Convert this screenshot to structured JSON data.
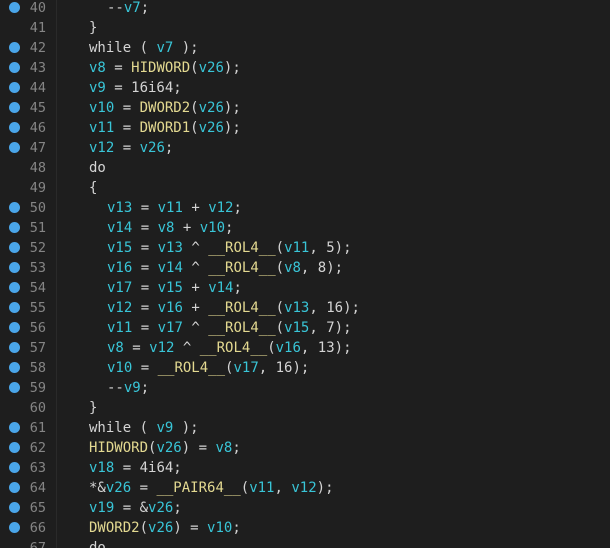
{
  "editor": {
    "colors": {
      "background": "#1e1e1e",
      "breakpoint": "#4aa5e8",
      "line_number": "#858585",
      "identifier": "#39c5d7",
      "function": "#e3d991",
      "text": "#d4d4d4"
    },
    "lines": [
      {
        "num": "40",
        "bp": true,
        "indent": 2,
        "tokens": [
          {
            "t": "--",
            "k": "op"
          },
          {
            "t": "v7",
            "k": "id"
          },
          {
            "t": ";",
            "k": "op"
          }
        ]
      },
      {
        "num": "41",
        "bp": false,
        "indent": 1,
        "tokens": [
          {
            "t": "}",
            "k": "op"
          }
        ]
      },
      {
        "num": "42",
        "bp": true,
        "indent": 1,
        "tokens": [
          {
            "t": "while ( ",
            "k": "kw"
          },
          {
            "t": "v7",
            "k": "id"
          },
          {
            "t": " );",
            "k": "op"
          }
        ]
      },
      {
        "num": "43",
        "bp": true,
        "indent": 1,
        "tokens": [
          {
            "t": "v8",
            "k": "id"
          },
          {
            "t": " = ",
            "k": "op"
          },
          {
            "t": "HIDWORD",
            "k": "fn"
          },
          {
            "t": "(",
            "k": "op"
          },
          {
            "t": "v26",
            "k": "id"
          },
          {
            "t": ");",
            "k": "op"
          }
        ]
      },
      {
        "num": "44",
        "bp": true,
        "indent": 1,
        "tokens": [
          {
            "t": "v9",
            "k": "id"
          },
          {
            "t": " = 16i64;",
            "k": "op"
          }
        ]
      },
      {
        "num": "45",
        "bp": true,
        "indent": 1,
        "tokens": [
          {
            "t": "v10",
            "k": "id"
          },
          {
            "t": " = ",
            "k": "op"
          },
          {
            "t": "DWORD2",
            "k": "fn"
          },
          {
            "t": "(",
            "k": "op"
          },
          {
            "t": "v26",
            "k": "id"
          },
          {
            "t": ");",
            "k": "op"
          }
        ]
      },
      {
        "num": "46",
        "bp": true,
        "indent": 1,
        "tokens": [
          {
            "t": "v11",
            "k": "id"
          },
          {
            "t": " = ",
            "k": "op"
          },
          {
            "t": "DWORD1",
            "k": "fn"
          },
          {
            "t": "(",
            "k": "op"
          },
          {
            "t": "v26",
            "k": "id"
          },
          {
            "t": ");",
            "k": "op"
          }
        ]
      },
      {
        "num": "47",
        "bp": true,
        "indent": 1,
        "tokens": [
          {
            "t": "v12",
            "k": "id"
          },
          {
            "t": " = ",
            "k": "op"
          },
          {
            "t": "v26",
            "k": "id"
          },
          {
            "t": ";",
            "k": "op"
          }
        ]
      },
      {
        "num": "48",
        "bp": false,
        "indent": 1,
        "tokens": [
          {
            "t": "do",
            "k": "kw"
          }
        ]
      },
      {
        "num": "49",
        "bp": false,
        "indent": 1,
        "tokens": [
          {
            "t": "{",
            "k": "op"
          }
        ]
      },
      {
        "num": "50",
        "bp": true,
        "indent": 2,
        "tokens": [
          {
            "t": "v13",
            "k": "id"
          },
          {
            "t": " = ",
            "k": "op"
          },
          {
            "t": "v11",
            "k": "id"
          },
          {
            "t": " + ",
            "k": "op"
          },
          {
            "t": "v12",
            "k": "id"
          },
          {
            "t": ";",
            "k": "op"
          }
        ]
      },
      {
        "num": "51",
        "bp": true,
        "indent": 2,
        "tokens": [
          {
            "t": "v14",
            "k": "id"
          },
          {
            "t": " = ",
            "k": "op"
          },
          {
            "t": "v8",
            "k": "id"
          },
          {
            "t": " + ",
            "k": "op"
          },
          {
            "t": "v10",
            "k": "id"
          },
          {
            "t": ";",
            "k": "op"
          }
        ]
      },
      {
        "num": "52",
        "bp": true,
        "indent": 2,
        "tokens": [
          {
            "t": "v15",
            "k": "id"
          },
          {
            "t": " = ",
            "k": "op"
          },
          {
            "t": "v13",
            "k": "id"
          },
          {
            "t": " ^ ",
            "k": "op"
          },
          {
            "t": "__ROL4__",
            "k": "fn"
          },
          {
            "t": "(",
            "k": "op"
          },
          {
            "t": "v11",
            "k": "id"
          },
          {
            "t": ", 5);",
            "k": "op"
          }
        ]
      },
      {
        "num": "53",
        "bp": true,
        "indent": 2,
        "tokens": [
          {
            "t": "v16",
            "k": "id"
          },
          {
            "t": " = ",
            "k": "op"
          },
          {
            "t": "v14",
            "k": "id"
          },
          {
            "t": " ^ ",
            "k": "op"
          },
          {
            "t": "__ROL4__",
            "k": "fn"
          },
          {
            "t": "(",
            "k": "op"
          },
          {
            "t": "v8",
            "k": "id"
          },
          {
            "t": ", 8);",
            "k": "op"
          }
        ]
      },
      {
        "num": "54",
        "bp": true,
        "indent": 2,
        "tokens": [
          {
            "t": "v17",
            "k": "id"
          },
          {
            "t": " = ",
            "k": "op"
          },
          {
            "t": "v15",
            "k": "id"
          },
          {
            "t": " + ",
            "k": "op"
          },
          {
            "t": "v14",
            "k": "id"
          },
          {
            "t": ";",
            "k": "op"
          }
        ]
      },
      {
        "num": "55",
        "bp": true,
        "indent": 2,
        "tokens": [
          {
            "t": "v12",
            "k": "id"
          },
          {
            "t": " = ",
            "k": "op"
          },
          {
            "t": "v16",
            "k": "id"
          },
          {
            "t": " + ",
            "k": "op"
          },
          {
            "t": "__ROL4__",
            "k": "fn"
          },
          {
            "t": "(",
            "k": "op"
          },
          {
            "t": "v13",
            "k": "id"
          },
          {
            "t": ", 16);",
            "k": "op"
          }
        ]
      },
      {
        "num": "56",
        "bp": true,
        "indent": 2,
        "tokens": [
          {
            "t": "v11",
            "k": "id"
          },
          {
            "t": " = ",
            "k": "op"
          },
          {
            "t": "v17",
            "k": "id"
          },
          {
            "t": " ^ ",
            "k": "op"
          },
          {
            "t": "__ROL4__",
            "k": "fn"
          },
          {
            "t": "(",
            "k": "op"
          },
          {
            "t": "v15",
            "k": "id"
          },
          {
            "t": ", 7);",
            "k": "op"
          }
        ]
      },
      {
        "num": "57",
        "bp": true,
        "indent": 2,
        "tokens": [
          {
            "t": "v8",
            "k": "id"
          },
          {
            "t": " = ",
            "k": "op"
          },
          {
            "t": "v12",
            "k": "id"
          },
          {
            "t": " ^ ",
            "k": "op"
          },
          {
            "t": "__ROL4__",
            "k": "fn"
          },
          {
            "t": "(",
            "k": "op"
          },
          {
            "t": "v16",
            "k": "id"
          },
          {
            "t": ", 13);",
            "k": "op"
          }
        ]
      },
      {
        "num": "58",
        "bp": true,
        "indent": 2,
        "tokens": [
          {
            "t": "v10",
            "k": "id"
          },
          {
            "t": " = ",
            "k": "op"
          },
          {
            "t": "__ROL4__",
            "k": "fn"
          },
          {
            "t": "(",
            "k": "op"
          },
          {
            "t": "v17",
            "k": "id"
          },
          {
            "t": ", 16);",
            "k": "op"
          }
        ]
      },
      {
        "num": "59",
        "bp": true,
        "indent": 2,
        "tokens": [
          {
            "t": "--",
            "k": "op"
          },
          {
            "t": "v9",
            "k": "id"
          },
          {
            "t": ";",
            "k": "op"
          }
        ]
      },
      {
        "num": "60",
        "bp": false,
        "indent": 1,
        "tokens": [
          {
            "t": "}",
            "k": "op"
          }
        ]
      },
      {
        "num": "61",
        "bp": true,
        "indent": 1,
        "tokens": [
          {
            "t": "while ( ",
            "k": "kw"
          },
          {
            "t": "v9",
            "k": "id"
          },
          {
            "t": " );",
            "k": "op"
          }
        ]
      },
      {
        "num": "62",
        "bp": true,
        "indent": 1,
        "tokens": [
          {
            "t": "HIDWORD",
            "k": "fn"
          },
          {
            "t": "(",
            "k": "op"
          },
          {
            "t": "v26",
            "k": "id"
          },
          {
            "t": ") = ",
            "k": "op"
          },
          {
            "t": "v8",
            "k": "id"
          },
          {
            "t": ";",
            "k": "op"
          }
        ]
      },
      {
        "num": "63",
        "bp": true,
        "indent": 1,
        "tokens": [
          {
            "t": "v18",
            "k": "id"
          },
          {
            "t": " = 4i64;",
            "k": "op"
          }
        ]
      },
      {
        "num": "64",
        "bp": true,
        "indent": 1,
        "tokens": [
          {
            "t": "*&",
            "k": "op"
          },
          {
            "t": "v26",
            "k": "id"
          },
          {
            "t": " = ",
            "k": "op"
          },
          {
            "t": "__PAIR64__",
            "k": "fn"
          },
          {
            "t": "(",
            "k": "op"
          },
          {
            "t": "v11",
            "k": "id"
          },
          {
            "t": ", ",
            "k": "op"
          },
          {
            "t": "v12",
            "k": "id"
          },
          {
            "t": ");",
            "k": "op"
          }
        ]
      },
      {
        "num": "65",
        "bp": true,
        "indent": 1,
        "tokens": [
          {
            "t": "v19",
            "k": "id"
          },
          {
            "t": " = &",
            "k": "op"
          },
          {
            "t": "v26",
            "k": "id"
          },
          {
            "t": ";",
            "k": "op"
          }
        ]
      },
      {
        "num": "66",
        "bp": true,
        "indent": 1,
        "tokens": [
          {
            "t": "DWORD2",
            "k": "fn"
          },
          {
            "t": "(",
            "k": "op"
          },
          {
            "t": "v26",
            "k": "id"
          },
          {
            "t": ") = ",
            "k": "op"
          },
          {
            "t": "v10",
            "k": "id"
          },
          {
            "t": ";",
            "k": "op"
          }
        ]
      },
      {
        "num": "67",
        "bp": false,
        "indent": 1,
        "tokens": [
          {
            "t": "do",
            "k": "kw"
          }
        ]
      }
    ]
  }
}
